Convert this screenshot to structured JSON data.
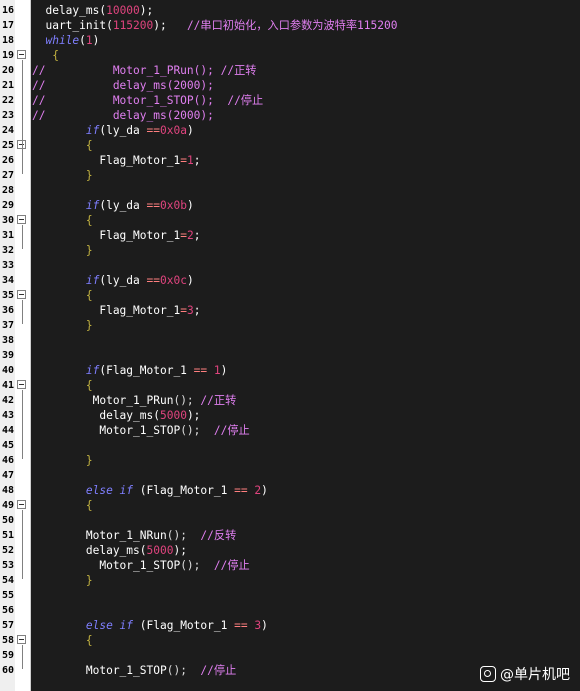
{
  "code_lines": [
    {
      "n": "16",
      "t": [
        [
          "f",
          "  delay_ms("
        ],
        [
          "num",
          "10000"
        ],
        [
          "f",
          ");"
        ]
      ]
    },
    {
      "n": "17",
      "t": [
        [
          "f",
          "  uart_init("
        ],
        [
          "num",
          "115200"
        ],
        [
          "f",
          ");   "
        ],
        [
          "cm",
          "//串口初始化，入口参数为波特率115200"
        ]
      ]
    },
    {
      "n": "18",
      "t": [
        [
          "kw",
          "  while"
        ],
        [
          "f",
          "("
        ],
        [
          "num",
          "1"
        ],
        [
          "f",
          ")"
        ]
      ]
    },
    {
      "n": "19",
      "fold": true,
      "t": [
        [
          "br",
          "   {"
        ]
      ]
    },
    {
      "n": "20",
      "t": [
        [
          "cm",
          "//          Motor_1_PRun(); //正转"
        ]
      ]
    },
    {
      "n": "21",
      "t": [
        [
          "cm",
          "//          delay_ms(2000);"
        ]
      ]
    },
    {
      "n": "22",
      "t": [
        [
          "cm",
          "//          Motor_1_STOP();  //停止"
        ]
      ]
    },
    {
      "n": "23",
      "t": [
        [
          "cm",
          "//          delay_ms(2000);"
        ]
      ]
    },
    {
      "n": "24",
      "t": [
        [
          "kw",
          "        if"
        ],
        [
          "f",
          "(ly_da "
        ],
        [
          "op",
          "=="
        ],
        [
          "num",
          "0x0a"
        ],
        [
          "f",
          ")"
        ]
      ]
    },
    {
      "n": "25",
      "fold": true,
      "t": [
        [
          "br",
          "        {"
        ]
      ]
    },
    {
      "n": "26",
      "t": [
        [
          "f",
          "          Flag_Motor_1"
        ],
        [
          "op",
          "="
        ],
        [
          "num",
          "1"
        ],
        [
          "f",
          ";"
        ]
      ]
    },
    {
      "n": "27",
      "t": [
        [
          "br",
          "        }"
        ]
      ]
    },
    {
      "n": "28",
      "t": []
    },
    {
      "n": "29",
      "t": [
        [
          "kw",
          "        if"
        ],
        [
          "f",
          "(ly_da "
        ],
        [
          "op",
          "=="
        ],
        [
          "num",
          "0x0b"
        ],
        [
          "f",
          ")"
        ]
      ]
    },
    {
      "n": "30",
      "fold": true,
      "t": [
        [
          "br",
          "        {"
        ]
      ]
    },
    {
      "n": "31",
      "t": [
        [
          "f",
          "          Flag_Motor_1"
        ],
        [
          "op",
          "="
        ],
        [
          "num",
          "2"
        ],
        [
          "f",
          ";"
        ]
      ]
    },
    {
      "n": "32",
      "t": [
        [
          "br",
          "        }"
        ]
      ]
    },
    {
      "n": "33",
      "t": []
    },
    {
      "n": "34",
      "t": [
        [
          "kw",
          "        if"
        ],
        [
          "f",
          "(ly_da "
        ],
        [
          "op",
          "=="
        ],
        [
          "num",
          "0x0c"
        ],
        [
          "f",
          ")"
        ]
      ]
    },
    {
      "n": "35",
      "fold": true,
      "t": [
        [
          "br",
          "        {"
        ]
      ]
    },
    {
      "n": "36",
      "t": [
        [
          "f",
          "          Flag_Motor_1"
        ],
        [
          "op",
          "="
        ],
        [
          "num",
          "3"
        ],
        [
          "f",
          ";"
        ]
      ]
    },
    {
      "n": "37",
      "t": [
        [
          "br",
          "        }"
        ]
      ]
    },
    {
      "n": "38",
      "t": []
    },
    {
      "n": "39",
      "t": []
    },
    {
      "n": "40",
      "t": [
        [
          "kw",
          "        if"
        ],
        [
          "f",
          "(Flag_Motor_1 "
        ],
        [
          "op",
          "=="
        ],
        [
          "f",
          " "
        ],
        [
          "num",
          "1"
        ],
        [
          "f",
          ")"
        ]
      ]
    },
    {
      "n": "41",
      "fold": true,
      "t": [
        [
          "br",
          "        {"
        ]
      ]
    },
    {
      "n": "42",
      "t": [
        [
          "f",
          "         Motor_1_PRun"
        ],
        [
          "pn",
          "();"
        ],
        [
          "f",
          " "
        ],
        [
          "cm",
          "//正转"
        ]
      ]
    },
    {
      "n": "43",
      "t": [
        [
          "f",
          "          delay_ms("
        ],
        [
          "num",
          "5000"
        ],
        [
          "f",
          ");"
        ]
      ]
    },
    {
      "n": "44",
      "t": [
        [
          "f",
          "          Motor_1_STOP"
        ],
        [
          "pn",
          "();"
        ],
        [
          "f",
          "  "
        ],
        [
          "cm",
          "//停止"
        ]
      ]
    },
    {
      "n": "45",
      "t": []
    },
    {
      "n": "46",
      "t": [
        [
          "br",
          "        }"
        ]
      ]
    },
    {
      "n": "47",
      "t": []
    },
    {
      "n": "48",
      "t": [
        [
          "kw",
          "        else if"
        ],
        [
          "f",
          " (Flag_Motor_1 "
        ],
        [
          "op",
          "=="
        ],
        [
          "f",
          " "
        ],
        [
          "num",
          "2"
        ],
        [
          "f",
          ")"
        ]
      ]
    },
    {
      "n": "49",
      "fold": true,
      "t": [
        [
          "br",
          "        {"
        ]
      ]
    },
    {
      "n": "50",
      "t": []
    },
    {
      "n": "51",
      "t": [
        [
          "f",
          "        Motor_1_NRun"
        ],
        [
          "pn",
          "();"
        ],
        [
          "f",
          "  "
        ],
        [
          "cm",
          "//反转"
        ]
      ]
    },
    {
      "n": "52",
      "t": [
        [
          "f",
          "        delay_ms("
        ],
        [
          "num",
          "5000"
        ],
        [
          "f",
          ");"
        ]
      ]
    },
    {
      "n": "53",
      "t": [
        [
          "f",
          "          Motor_1_STOP"
        ],
        [
          "pn",
          "();"
        ],
        [
          "f",
          "  "
        ],
        [
          "cm",
          "//停止"
        ]
      ]
    },
    {
      "n": "54",
      "t": [
        [
          "br",
          "        }"
        ]
      ]
    },
    {
      "n": "55",
      "t": []
    },
    {
      "n": "56",
      "t": []
    },
    {
      "n": "57",
      "t": [
        [
          "kw",
          "        else if"
        ],
        [
          "f",
          " (Flag_Motor_1 "
        ],
        [
          "op",
          "=="
        ],
        [
          "f",
          " "
        ],
        [
          "num",
          "3"
        ],
        [
          "f",
          ")"
        ]
      ]
    },
    {
      "n": "58",
      "fold": true,
      "t": [
        [
          "br",
          "        {"
        ]
      ]
    },
    {
      "n": "59",
      "t": []
    },
    {
      "n": "60",
      "t": [
        [
          "f",
          "        Motor_1_STOP"
        ],
        [
          "pn",
          "();"
        ],
        [
          "f",
          "  "
        ],
        [
          "cm",
          "//停止"
        ]
      ]
    }
  ],
  "watermark": {
    "icon": "chat-bubble-icon",
    "text": "@单片机吧"
  },
  "colors": {
    "background": "#1c1c1c",
    "keyword": "#7f7fff",
    "number": "#e0447e",
    "comment": "#e07ff0",
    "brace": "#c0b040",
    "operator": "#ff7f7f"
  }
}
